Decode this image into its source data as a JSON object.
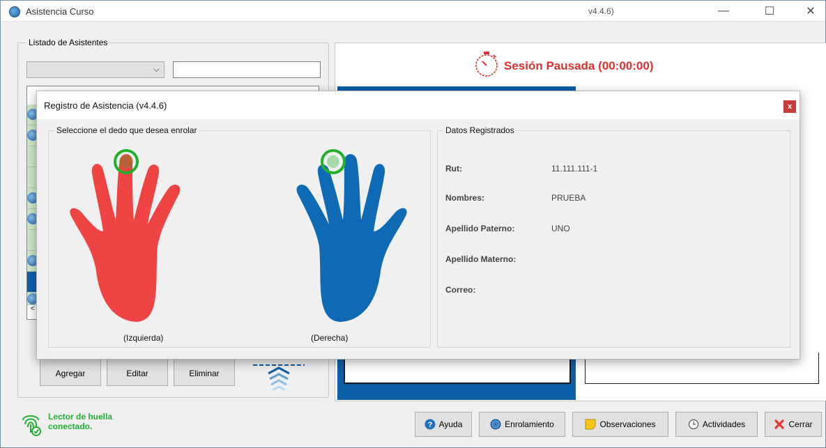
{
  "window": {
    "title": "Asistencia Curso",
    "version": "v4.4.6)",
    "controls": {
      "minimize": "—",
      "maximize": "☐",
      "close": "✕"
    }
  },
  "left_panel": {
    "legend": "Listado de Asistentes",
    "combo_chevron": "⌵",
    "scroll_left": "<",
    "buttons": {
      "add": "Agregar",
      "edit": "Editar",
      "delete": "Eliminar"
    }
  },
  "session": {
    "status": "Sesión Pausada (00:00:00)",
    "status_color": "#e03030"
  },
  "status_bar": {
    "reader_status": "Lector de huella conectado.",
    "reader_color": "#20b030"
  },
  "bottom_buttons": {
    "help": "Ayuda",
    "enrollment": "Enrolamiento",
    "observations": "Observaciones",
    "activities": "Actividades",
    "close": "Cerrar"
  },
  "dialog": {
    "title": "Registro de Asistencia (v4.4.6)",
    "close": "x",
    "hands_legend": "Seleccione el dedo que desea enrolar",
    "left_hand": {
      "caption": "(Izquierda)",
      "color": "#ef4444"
    },
    "right_hand": {
      "caption": "(Derecha)",
      "color": "#0e6ab5"
    },
    "finger_marker_color": "#22b02a",
    "data_legend": "Datos Registrados",
    "fields": [
      {
        "label": "Rut:",
        "value": "11.111.111-1"
      },
      {
        "label": "Nombres:",
        "value": "PRUEBA"
      },
      {
        "label": "Apellido Paterno:",
        "value": "UNO"
      },
      {
        "label": "Apellido Materno:",
        "value": ""
      },
      {
        "label": "Correo:",
        "value": ""
      }
    ]
  }
}
